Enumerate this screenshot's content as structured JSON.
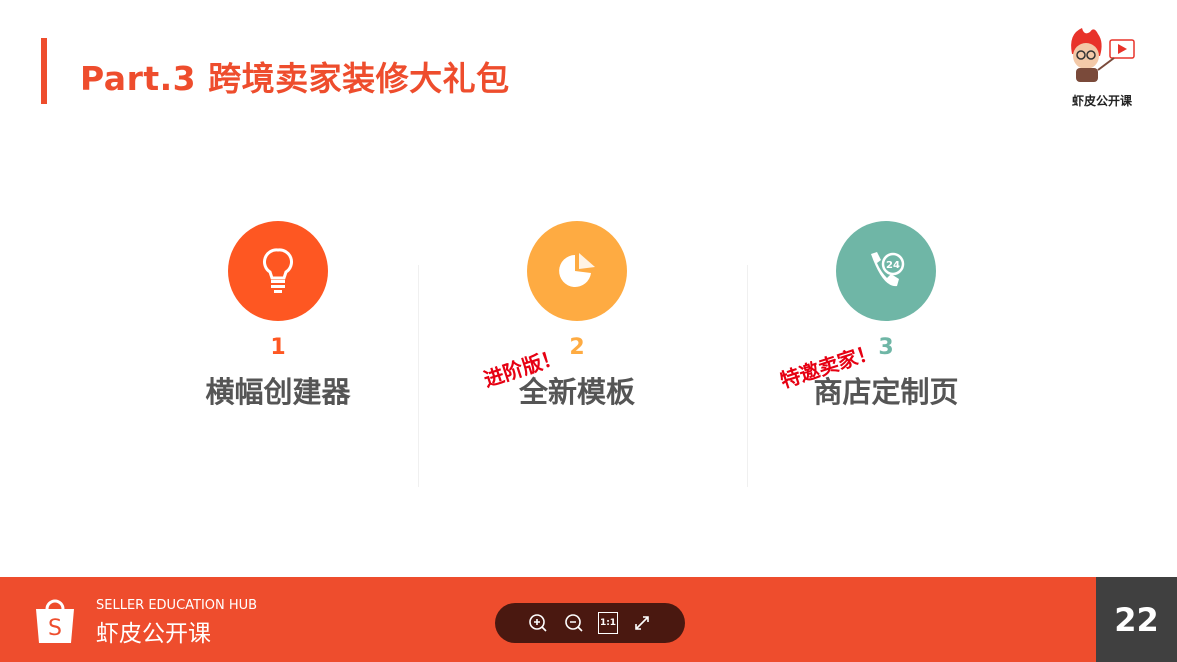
{
  "header": {
    "title": "Part.3 跨境卖家装修大礼包",
    "logo_text": "虾皮公开课"
  },
  "items": [
    {
      "num": "1",
      "name": "横幅创建器",
      "color": "#fe5722",
      "icon": "lightbulb-icon"
    },
    {
      "num": "2",
      "name": "全新模板",
      "color": "#feab42",
      "icon": "pie-chart-icon",
      "tag": "进阶版！"
    },
    {
      "num": "3",
      "name": "商店定制页",
      "color": "#6fb6a6",
      "icon": "phone-24-icon",
      "tag": "特邀卖家！"
    }
  ],
  "footer": {
    "hub_en": "SELLER EDUCATION HUB",
    "hub_cn": "虾皮公开课",
    "page": "22",
    "accent": "#ee4d2d"
  },
  "controls": {
    "zoom_in": "zoom-in-icon",
    "zoom_out": "zoom-out-icon",
    "actual_size": "1:1",
    "fullscreen": "expand-icon"
  }
}
